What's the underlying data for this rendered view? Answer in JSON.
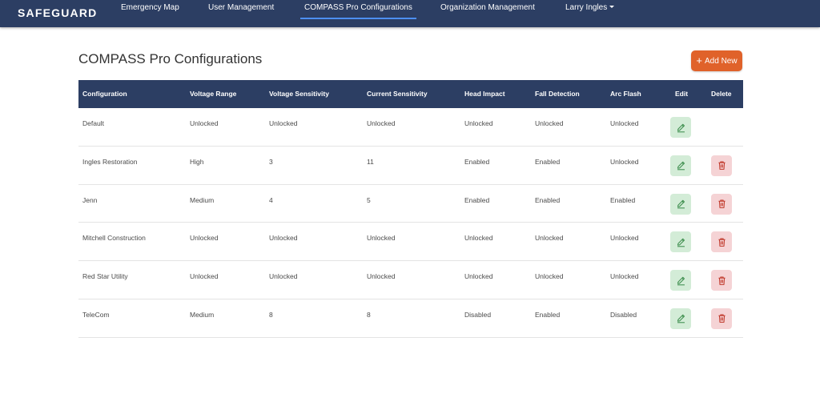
{
  "navbar": {
    "brand": "SAFEGUARD",
    "links": [
      "Emergency Map",
      "User Management",
      "COMPASS Pro Configurations",
      "Organization Management"
    ],
    "user": "Larry Ingles"
  },
  "page": {
    "title": "COMPASS Pro Configurations",
    "add_label": "Add New"
  },
  "table": {
    "headers": [
      "Configuration",
      "Voltage Range",
      "Voltage Sensitivity",
      "Current Sensitivity",
      "Head Impact",
      "Fall Detection",
      "Arc Flash",
      "Edit",
      "Delete"
    ],
    "rows": [
      [
        "Default",
        "Unlocked",
        "Unlocked",
        "Unlocked",
        "Unlocked",
        "Unlocked",
        "Unlocked"
      ],
      [
        "Ingles Restoration",
        "High",
        "3",
        "11",
        "Enabled",
        "Enabled",
        "Unlocked"
      ],
      [
        "Jenn",
        "Medium",
        "4",
        "5",
        "Enabled",
        "Enabled",
        "Enabled"
      ],
      [
        "Mitchell Construction",
        "Unlocked",
        "Unlocked",
        "Unlocked",
        "Unlocked",
        "Unlocked",
        "Unlocked"
      ],
      [
        "Red Star Utility",
        "Unlocked",
        "Unlocked",
        "Unlocked",
        "Unlocked",
        "Unlocked",
        "Unlocked"
      ],
      [
        "TeleCom",
        "Medium",
        "8",
        "8",
        "Disabled",
        "Enabled",
        "Disabled"
      ]
    ],
    "row_has_delete": [
      false,
      true,
      true,
      true,
      true,
      true
    ]
  },
  "colors": {
    "navbar": "#2c3e63",
    "active_underline": "#4d8ff5",
    "add_button": "#e0622a",
    "edit_button_bg": "#d3ecd7",
    "edit_icon": "#3f8f4f",
    "delete_button_bg": "#f5d3d5",
    "delete_icon": "#c0392b"
  },
  "icons": {
    "edit": "pencil-icon",
    "delete": "trash-icon",
    "add": "plus-icon",
    "user_menu": "caret-down-icon"
  }
}
